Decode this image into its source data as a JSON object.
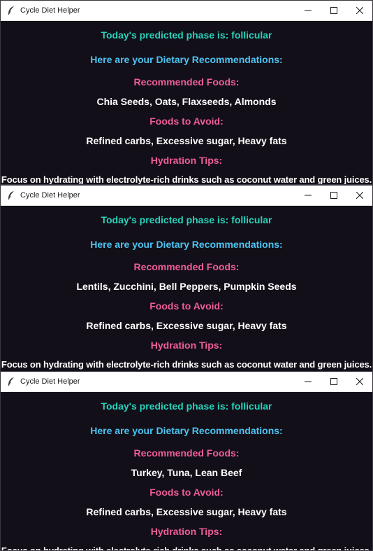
{
  "windows": [
    {
      "title": "Cycle Diet Helper",
      "phase_text": "Today's predicted phase is: follicular",
      "recommendations_heading": "Here are your Dietary Recommendations:",
      "recommended_label": "Recommended Foods:",
      "recommended_foods": "Chia Seeds, Oats, Flaxseeds, Almonds",
      "avoid_label": "Foods to Avoid:",
      "avoid_foods": "Refined carbs, Excessive sugar, Heavy fats",
      "hydration_label": "Hydration Tips:",
      "hydration_tip": "Focus on hydrating with electrolyte-rich drinks such as coconut water and green juices."
    },
    {
      "title": "Cycle Diet Helper",
      "phase_text": "Today's predicted phase is: follicular",
      "recommendations_heading": "Here are your Dietary Recommendations:",
      "recommended_label": "Recommended Foods:",
      "recommended_foods": "Lentils, Zucchini, Bell Peppers, Pumpkin Seeds",
      "avoid_label": "Foods to Avoid:",
      "avoid_foods": "Refined carbs, Excessive sugar, Heavy fats",
      "hydration_label": "Hydration Tips:",
      "hydration_tip": "Focus on hydrating with electrolyte-rich drinks such as coconut water and green juices."
    },
    {
      "title": "Cycle Diet Helper",
      "phase_text": "Today's predicted phase is: follicular",
      "recommendations_heading": "Here are your Dietary Recommendations:",
      "recommended_label": "Recommended Foods:",
      "recommended_foods": "Turkey, Tuna, Lean Beef",
      "avoid_label": "Foods to Avoid:",
      "avoid_foods": "Refined carbs, Excessive sugar, Heavy fats",
      "hydration_label": "Hydration Tips:",
      "hydration_tip": "Focus on hydrating with electrolyte-rich drinks such as coconut water and green juices."
    }
  ],
  "icons": {
    "app": "feather-icon",
    "minimize": "minimize-icon",
    "maximize": "maximize-icon",
    "close": "close-icon"
  },
  "colors": {
    "window_background": "#130f18",
    "phase_text": "#27d3bd",
    "recommendations_heading": "#4cc4f2",
    "section_label": "#ef5d9a",
    "body_text": "#ffffff",
    "titlebar": "#ffffff"
  }
}
